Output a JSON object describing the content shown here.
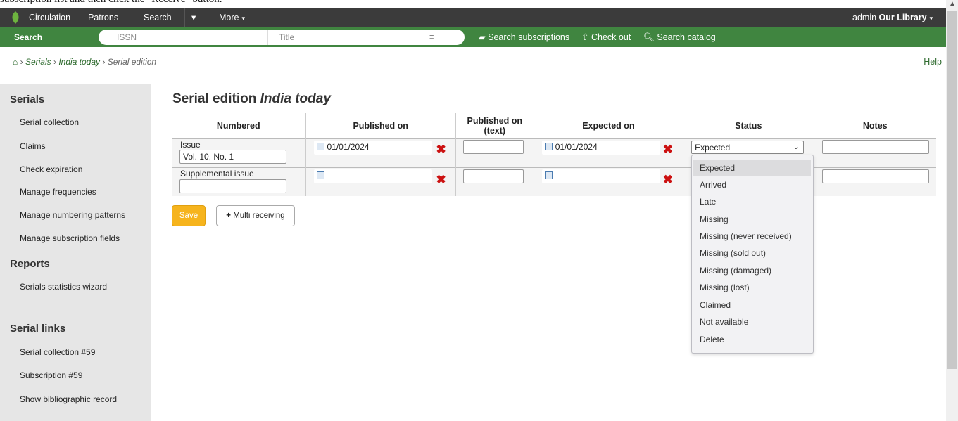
{
  "instruction_fragment": "subscription list and then click the \"Receive\" button.",
  "topnav": {
    "items": [
      "Circulation",
      "Patrons",
      "Search",
      "More"
    ],
    "user": "admin",
    "library": "Our Library"
  },
  "searchbar": {
    "tab_label": "Search subscriptions",
    "issn_placeholder": "ISSN",
    "title_placeholder": "Title",
    "links": [
      "Search subscriptions",
      "Check out",
      "Search catalog"
    ]
  },
  "breadcrumb": {
    "items": [
      "Serials",
      "India today"
    ],
    "current": "Serial edition"
  },
  "help": "Help",
  "sidebar": {
    "serials_heading": "Serials",
    "serials_items": [
      "Serial collection",
      "Claims",
      "Check expiration",
      "Manage frequencies",
      "Manage numbering patterns",
      "Manage subscription fields"
    ],
    "reports_heading": "Reports",
    "reports_items": [
      "Serials statistics wizard"
    ],
    "links_heading": "Serial links",
    "links_items": [
      "Serial collection #59",
      "Subscription #59",
      "Show bibliographic record"
    ]
  },
  "page": {
    "title_prefix": "Serial edition",
    "title_italic": "India today"
  },
  "table": {
    "headers": [
      "Numbered",
      "Published on",
      "Published on (text)",
      "Expected on",
      "Status",
      "Notes"
    ],
    "rows": [
      {
        "label": "Issue",
        "numbering": "Vol. 10, No. 1",
        "published": "01/01/2024",
        "published_text": "",
        "expected": "01/01/2024",
        "status": "Expected",
        "notes": ""
      },
      {
        "label": "Supplemental issue",
        "numbering": "",
        "published": "",
        "published_text": "",
        "expected": "",
        "status": "",
        "notes": ""
      }
    ]
  },
  "buttons": {
    "save": "Save",
    "multi_receiving": "Multi receiving"
  },
  "status_options": [
    "Expected",
    "Arrived",
    "Late",
    "Missing",
    "Missing (never received)",
    "Missing (sold out)",
    "Missing (damaged)",
    "Missing (lost)",
    "Claimed",
    "Not available",
    "Delete"
  ],
  "colors": {
    "topnav_bg": "#3b3b3b",
    "searchbar_bg": "#408540",
    "save_button": "#f6b41d",
    "remove_icon": "#cc1111"
  }
}
